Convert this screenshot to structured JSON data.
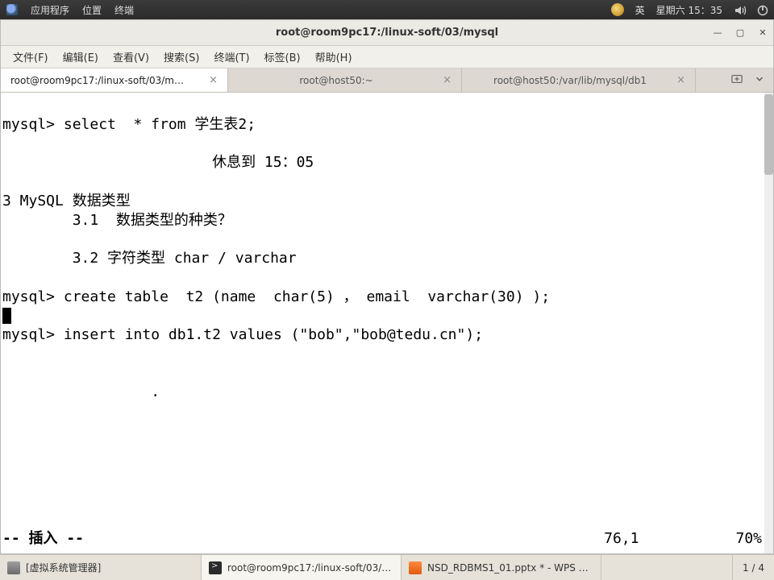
{
  "panel": {
    "apps": "应用程序",
    "places": "位置",
    "terminal_menu": "终端",
    "ime": "英",
    "clock": "星期六 15：35"
  },
  "window": {
    "title": "root@room9pc17:/linux-soft/03/mysql",
    "menus": {
      "file": "文件(F)",
      "edit": "编辑(E)",
      "view": "查看(V)",
      "search": "搜索(S)",
      "terminal": "终端(T)",
      "tab": "标签(B)",
      "help": "帮助(H)"
    },
    "tabs": {
      "t1": "root@room9pc17:/linux-soft/03/m…",
      "t2": "root@host50:~",
      "t3": "root@host50:/var/lib/mysql/db1"
    }
  },
  "term": {
    "l1": "mysql> select  * from 学生表2;",
    "l2": "                        休息到 15：05",
    "l3": "3 MySQL 数据类型",
    "l4": "        3.1  数据类型的种类？",
    "l5": "        3.2 字符类型 char / varchar",
    "l6": "mysql> create table  t2 (name  char(5) ， email  varchar(30) );",
    "l7": "mysql> insert into db1.t2 values (\"bob\",\"bob@tedu.cn\");",
    "l8": "                 .",
    "status_mode": "-- 插入 --",
    "status_pos": "76,1",
    "status_pct": "70%"
  },
  "taskbar": {
    "t1": "[虚拟系统管理器]",
    "t2": "root@room9pc17:/linux-soft/03/m…",
    "t3": "NSD_RDBMS1_01.pptx * - WPS …",
    "ws": "1 / 4"
  }
}
